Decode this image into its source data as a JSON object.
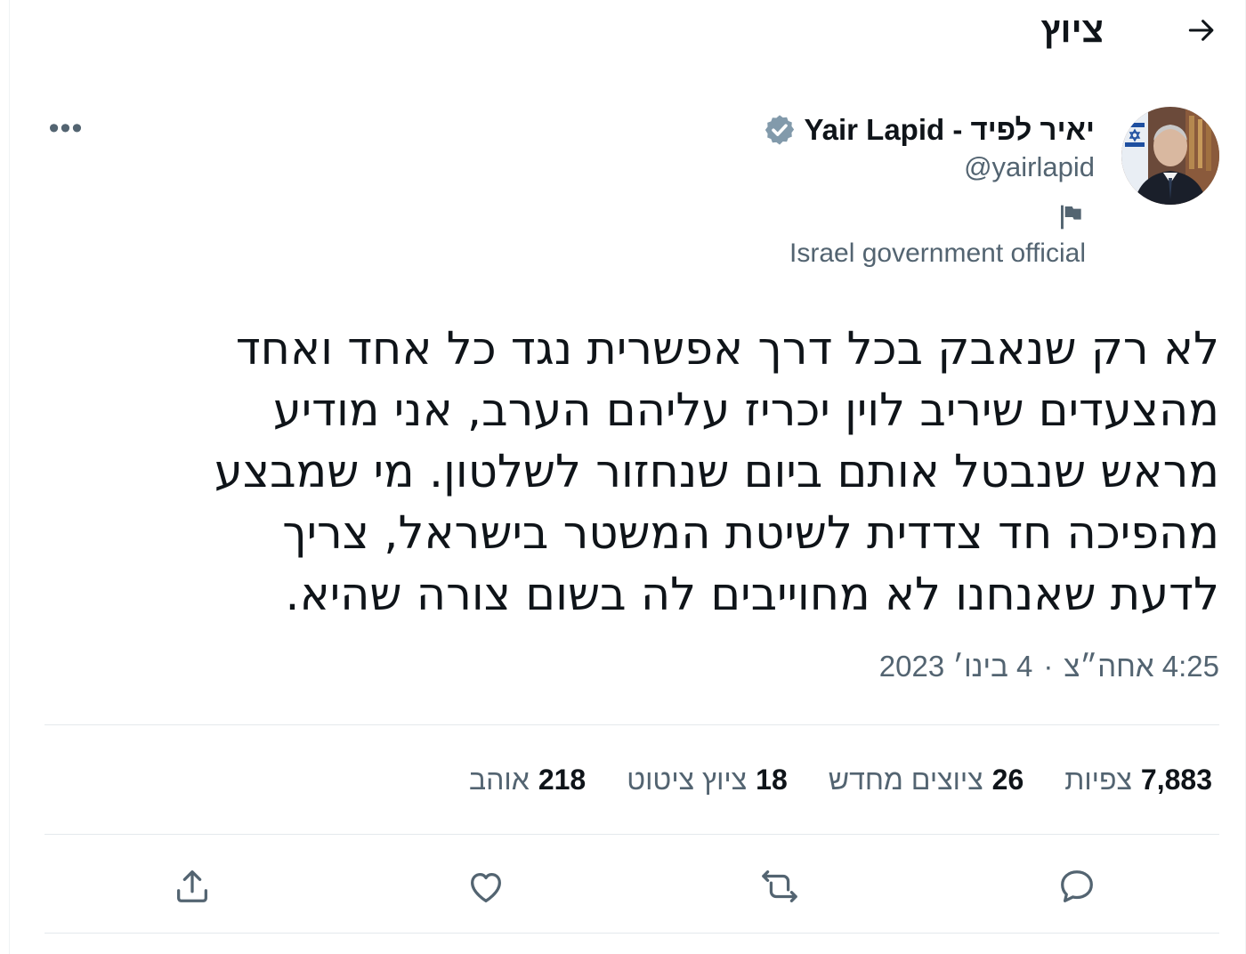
{
  "header": {
    "title": "ציוץ",
    "back_icon": "arrow-right-icon"
  },
  "author": {
    "name": "יאיר לפיד - Yair Lapid",
    "handle": "@yairlapid",
    "verified_icon": "verified-badge-icon",
    "label_icon": "flag-icon",
    "label": "Israel government official"
  },
  "tweet": {
    "lines": [
      "לא רק שנאבק בכל דרך אפשרית נגד כל אחד ואחד",
      "מהצעדים שיריב לוין יכריז עליהם הערב, אני מודיע",
      "מראש שנבטל אותם ביום שנחזור לשלטון. מי שמבצע",
      "מהפיכה חד צדדית לשיטת המשטר בישראל, צריך",
      "לדעת שאנחנו לא מחוייבים לה בשום צורה שהיא."
    ],
    "time": "4:25 אחה״צ",
    "separator": "·",
    "date": "4 בינו׳ 2023"
  },
  "stats": {
    "views_count": "7,883",
    "views_label": "צפיות",
    "retweets_count": "26",
    "retweets_label": "ציוצים מחדש",
    "quotes_count": "18",
    "quotes_label": "ציוץ ציטוט",
    "likes_count": "218",
    "likes_label": "אוהב"
  },
  "actions": [
    "reply-icon",
    "retweet-icon",
    "like-icon",
    "share-icon"
  ],
  "colors": {
    "text": "#0f1419",
    "secondary": "#536471",
    "divider": "#e4e9ec",
    "verified": "#829aab"
  }
}
